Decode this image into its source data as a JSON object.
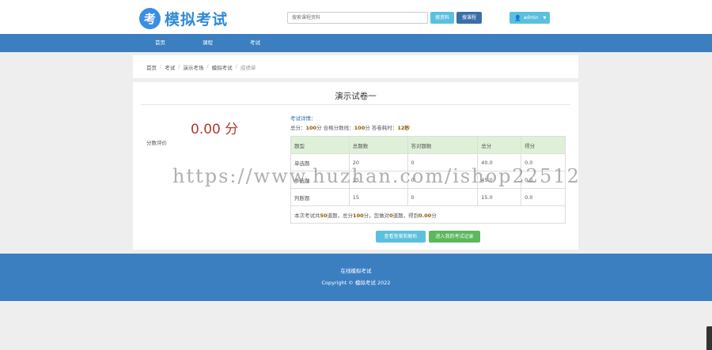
{
  "header": {
    "logo_char": "考",
    "logo_text": "模拟考试",
    "search_placeholder": "搜索课程资料",
    "search_material_btn": "搜资料",
    "search_course_btn": "搜课程",
    "user_name": "admin"
  },
  "nav": {
    "items": [
      "首页",
      "课程",
      "考试"
    ]
  },
  "breadcrumb": {
    "items": [
      "首页",
      "考试",
      "演示考场",
      "模拟考试",
      "成绩单"
    ],
    "separator": "/"
  },
  "result": {
    "paper_title": "演示试卷一",
    "score": "0.00 分",
    "eval_label": "分数评价",
    "detail_title": "考试详情：",
    "detail_prefix": "总分：",
    "total_score": "100",
    "pass_prefix": "分 合格分数线：",
    "pass_score": "100",
    "time_prefix": "分 答卷耗时：",
    "time_used": "12秒",
    "columns": [
      "题型",
      "总题数",
      "答对题数",
      "总分",
      "得分"
    ],
    "rows": [
      [
        "单选题",
        "20",
        "0",
        "40.0",
        "0.0"
      ],
      [
        "多选题",
        "15",
        "0",
        "45.0",
        "0.0"
      ],
      [
        "判断题",
        "15",
        "0",
        "15.0",
        "0.0"
      ]
    ],
    "summary_prefix": "本次考试共",
    "summary_total_questions": "50",
    "summary_mid1": "道题，总分",
    "summary_total_score": "100",
    "summary_mid2": "分，您做对",
    "summary_correct": "0",
    "summary_mid3": "道题，得到",
    "summary_got": "0.00",
    "summary_suffix": "分",
    "review_btn": "查看答案和解析",
    "record_btn": "进入我的考试记录"
  },
  "footer": {
    "site_name": "在线模拟考试",
    "copyright": "Copyright © 模拟考试 2022"
  },
  "watermark": "https://www.huzhan.com/ishop22512",
  "colors": {
    "primary": "#3b7fc1",
    "info": "#5bc0de",
    "success": "#5cb85c",
    "score": "#b23a2e",
    "table_header": "#dff0d8"
  }
}
